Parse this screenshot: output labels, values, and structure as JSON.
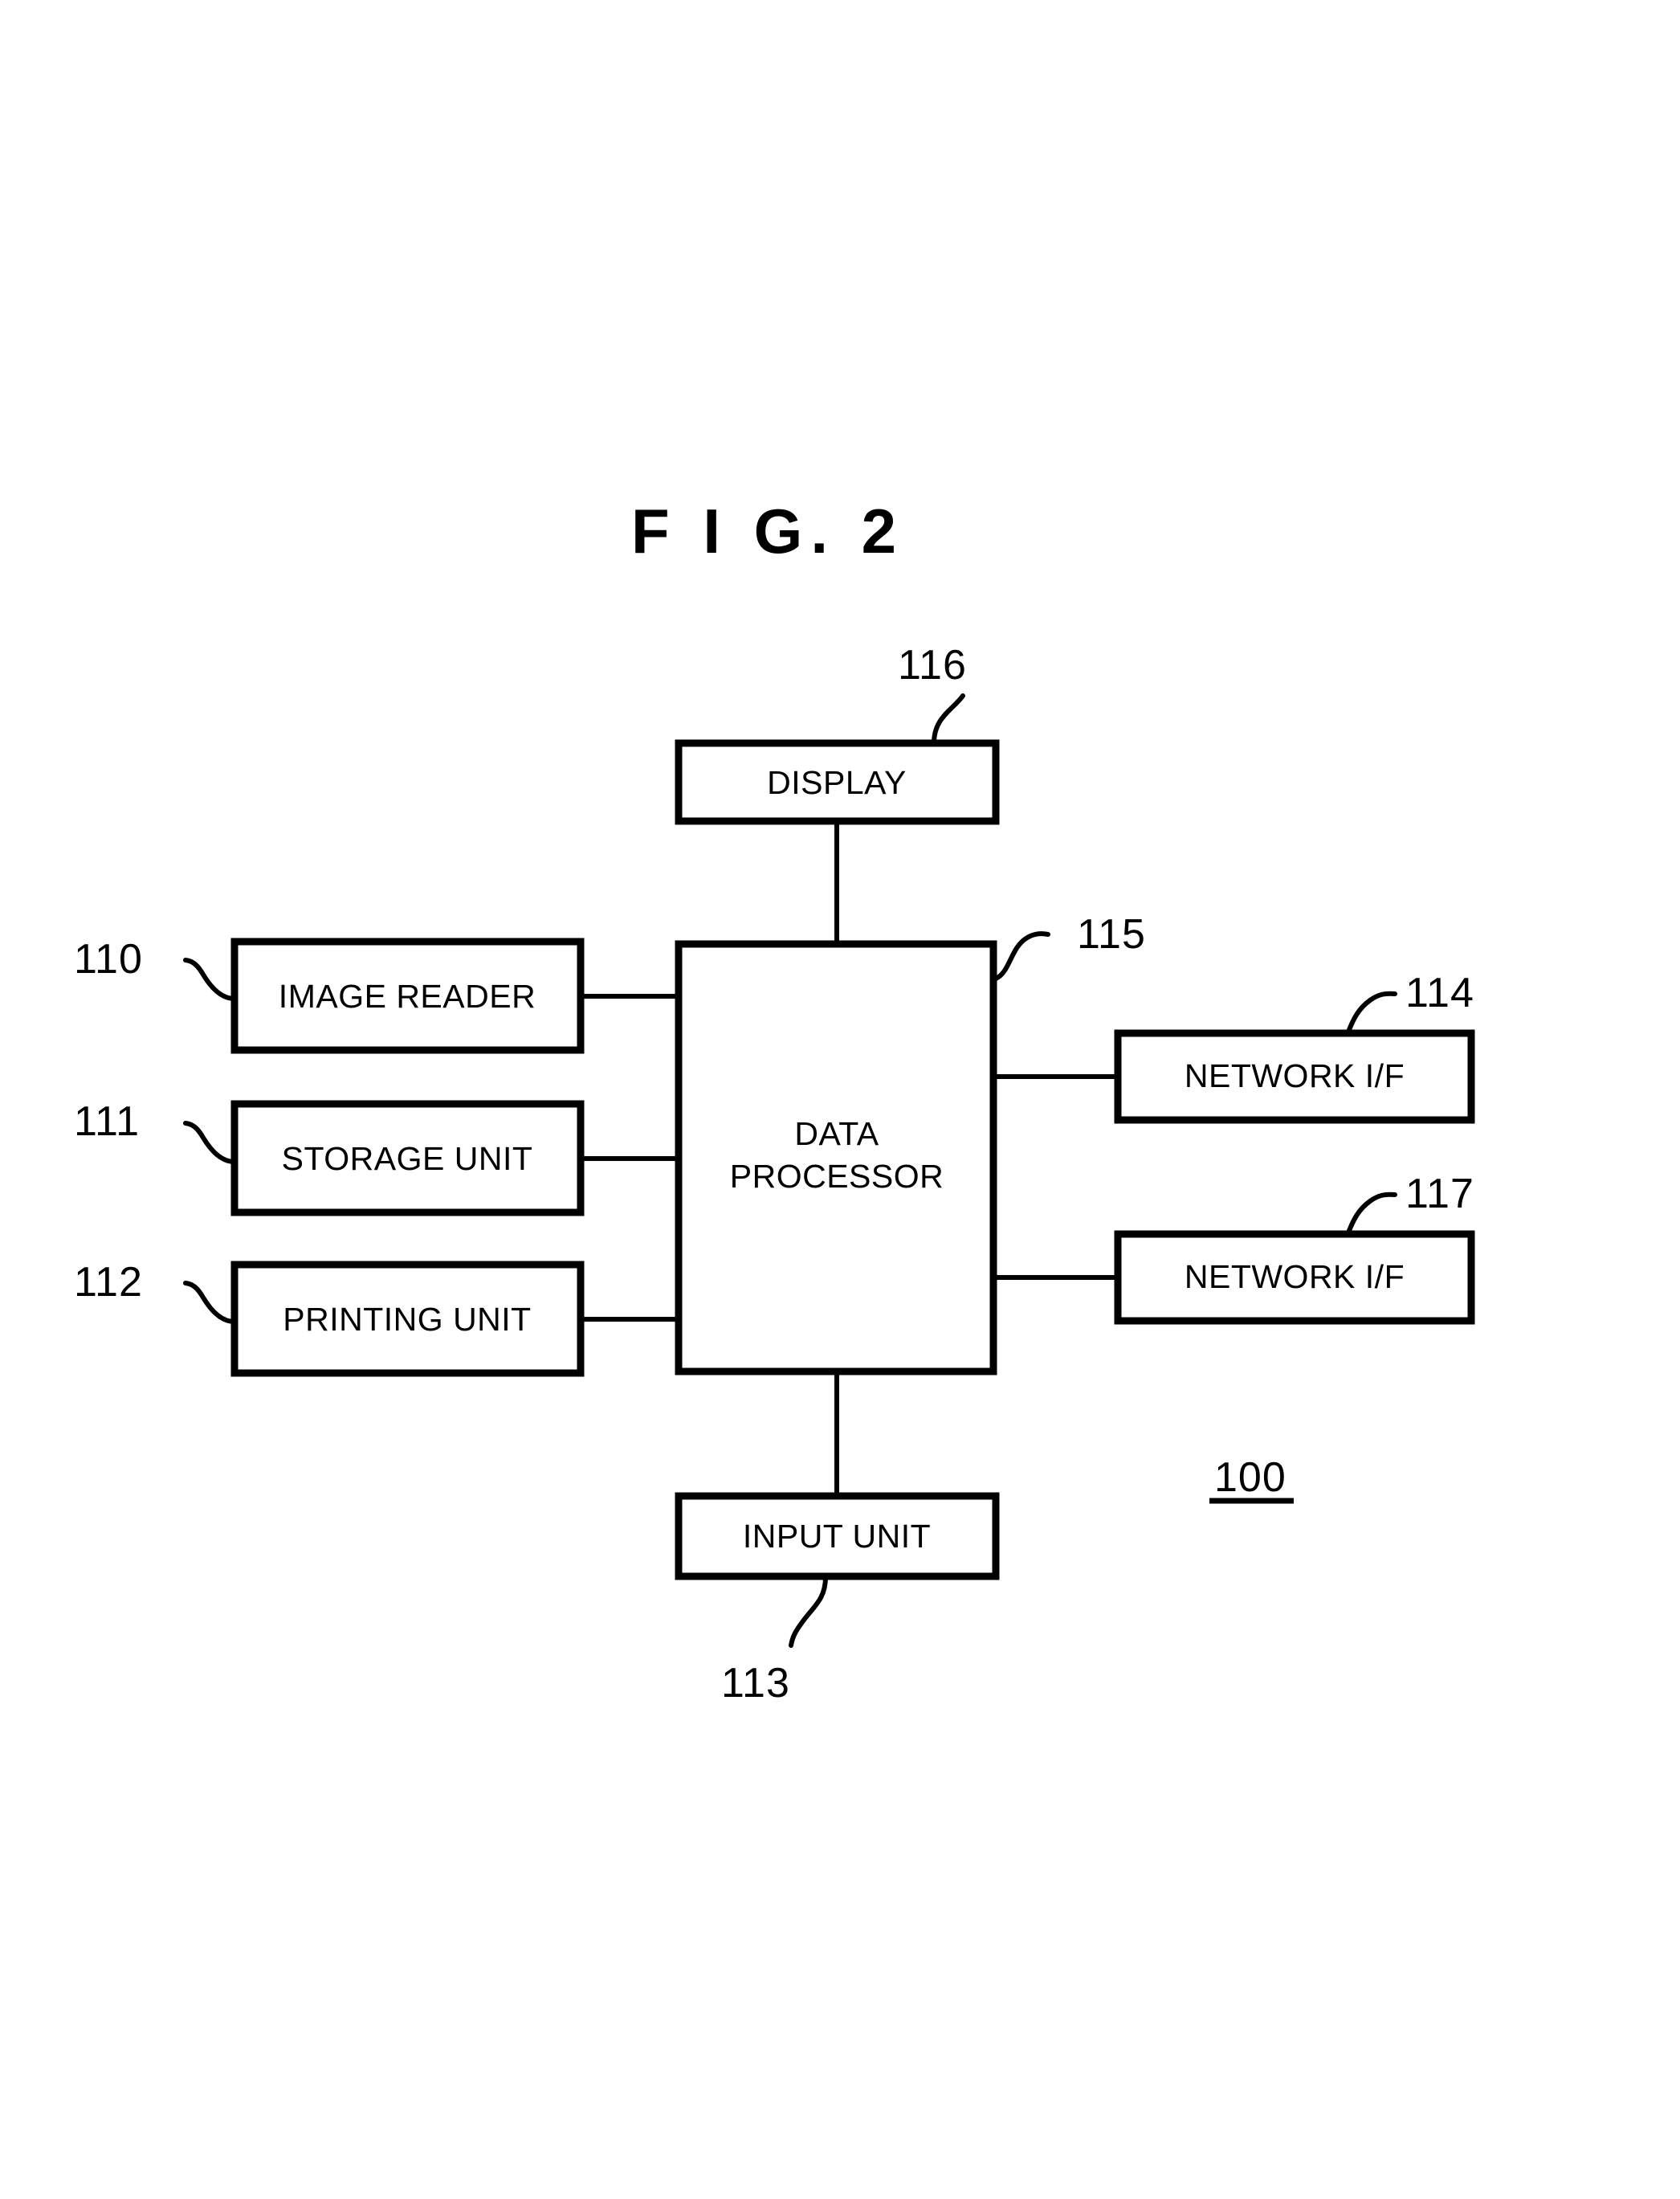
{
  "figure": {
    "title": "F I G.  2",
    "system_ref": "100"
  },
  "blocks": {
    "display": {
      "label": "DISPLAY",
      "ref": "116"
    },
    "image_reader": {
      "label": "IMAGE READER",
      "ref": "110"
    },
    "storage_unit": {
      "label": "STORAGE UNIT",
      "ref": "111"
    },
    "printing_unit": {
      "label": "PRINTING UNIT",
      "ref": "112"
    },
    "data_processor": {
      "label_line1": "DATA",
      "label_line2": "PROCESSOR",
      "ref": "115"
    },
    "network_if_top": {
      "label": "NETWORK I/F",
      "ref": "114"
    },
    "network_if_bottom": {
      "label": "NETWORK I/F",
      "ref": "117"
    },
    "input_unit": {
      "label": "INPUT UNIT",
      "ref": "113"
    }
  },
  "colors": {
    "ink": "#000000",
    "paper": "#ffffff"
  }
}
